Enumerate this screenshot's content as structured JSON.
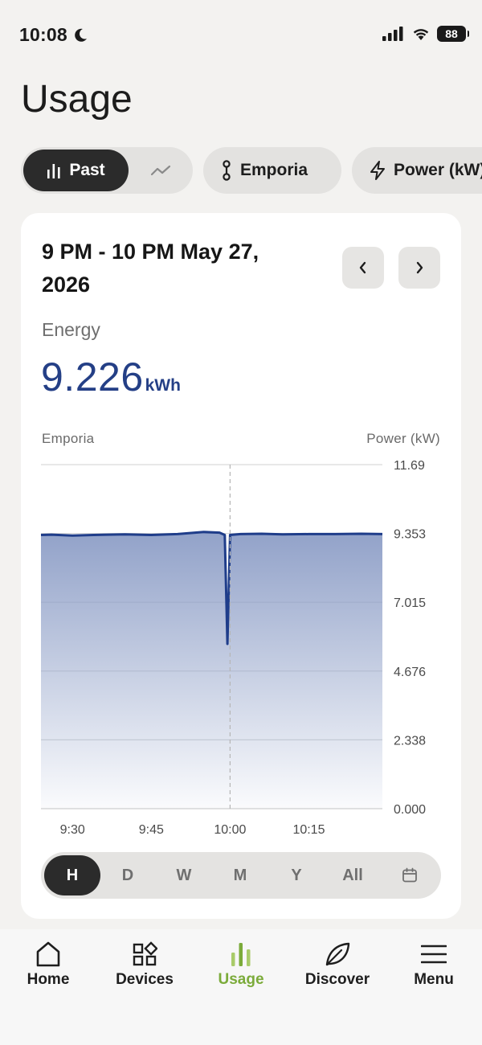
{
  "status": {
    "time": "10:08",
    "battery": "88"
  },
  "page": {
    "title": "Usage"
  },
  "filters": {
    "past_label": "Past",
    "device_label": "Emporia",
    "metric_label": "Power (kW)"
  },
  "card": {
    "range_title": "9 PM - 10 PM May 27, 2026",
    "energy_label": "Energy",
    "energy_value": "9.226",
    "energy_unit": "kWh"
  },
  "chart_data": {
    "type": "area",
    "series_label": "Emporia",
    "ylabel": "Power (kW)",
    "y_ticks": [
      "11.69",
      "9.353",
      "7.015",
      "4.676",
      "2.338",
      "0.000"
    ],
    "ylim": [
      0,
      11.69
    ],
    "x_ticks": [
      "9:30",
      "9:45",
      "10:00",
      "10:15"
    ],
    "grid": true,
    "x": [
      "9:24",
      "9:26",
      "9:30",
      "9:34",
      "9:40",
      "9:45",
      "9:50",
      "9:55",
      "9:58",
      "9:59",
      "9:59.5",
      "10:00",
      "10:02",
      "10:06",
      "10:10",
      "10:15",
      "10:20",
      "10:25",
      "10:29"
    ],
    "values": [
      9.3,
      9.31,
      9.28,
      9.3,
      9.32,
      9.3,
      9.33,
      9.4,
      9.38,
      9.3,
      5.6,
      9.3,
      9.33,
      9.34,
      9.32,
      9.33,
      9.33,
      9.34,
      9.33
    ],
    "line_color": "#1f3d8a",
    "fill_color": "#8c9dc6"
  },
  "period": {
    "options": [
      "H",
      "D",
      "W",
      "M",
      "Y",
      "All"
    ],
    "selected": "H"
  },
  "bottom_nav": {
    "items": [
      "Home",
      "Devices",
      "Usage",
      "Discover",
      "Menu"
    ],
    "active": "Usage",
    "active_color": "#7bab3a"
  }
}
